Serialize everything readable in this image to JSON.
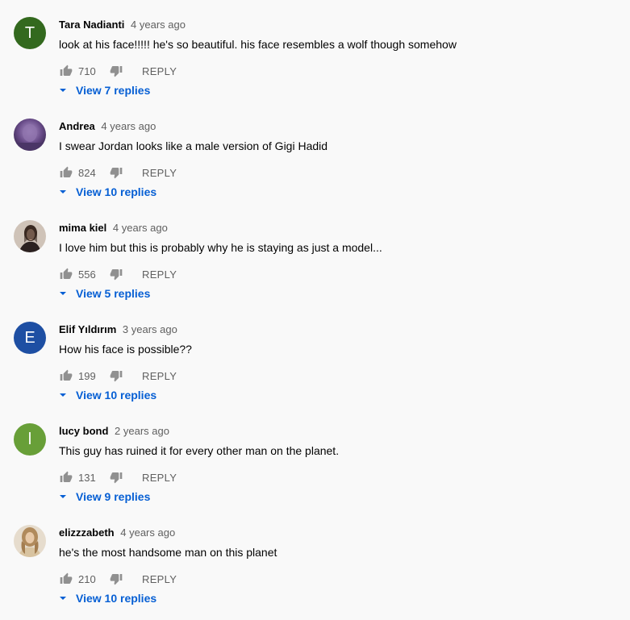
{
  "comments": [
    {
      "author": "Tara Nadianti",
      "time": "4 years ago",
      "text": "look at his face!!!!! he's so beautiful. his face resembles a wolf  though somehow",
      "likes": "710",
      "reply_label": "REPLY",
      "view_replies": "View 7 replies",
      "avatar": {
        "type": "letter",
        "letter": "T",
        "color": "#33691e"
      }
    },
    {
      "author": "Andrea",
      "time": "4 years ago",
      "text": "I swear Jordan looks like a male version of Gigi Hadid",
      "likes": "824",
      "reply_label": "REPLY",
      "view_replies": "View 10 replies",
      "avatar": {
        "type": "photo",
        "color": "#6a4d8a"
      }
    },
    {
      "author": "mima kiel",
      "time": "4 years ago",
      "text": "I love him but this is probably why he is staying as just a model...",
      "likes": "556",
      "reply_label": "REPLY",
      "view_replies": "View 5 replies",
      "avatar": {
        "type": "photo",
        "color": "#8d7a6b"
      }
    },
    {
      "author": "Elif Yıldırım",
      "time": "3 years ago",
      "text": "How his face is possible??",
      "likes": "199",
      "reply_label": "REPLY",
      "view_replies": "View 10 replies",
      "avatar": {
        "type": "letter",
        "letter": "E",
        "color": "#1e4fa3"
      }
    },
    {
      "author": "lucy bond",
      "time": "2 years ago",
      "text": "This guy has ruined it for every other man on the planet.",
      "likes": "131",
      "reply_label": "REPLY",
      "view_replies": "View 9 replies",
      "avatar": {
        "type": "letter",
        "letter": "l",
        "color": "#689f38"
      }
    },
    {
      "author": "elizzzabeth",
      "time": "4 years ago",
      "text": "he's the most handsome man on this planet",
      "likes": "210",
      "reply_label": "REPLY",
      "view_replies": "View 10 replies",
      "avatar": {
        "type": "photo",
        "color": "#c9b08e"
      }
    }
  ],
  "colors": {
    "link": "#065fd4",
    "secondary_text": "#606060",
    "primary_text": "#030303",
    "background": "#f9f9f9"
  }
}
